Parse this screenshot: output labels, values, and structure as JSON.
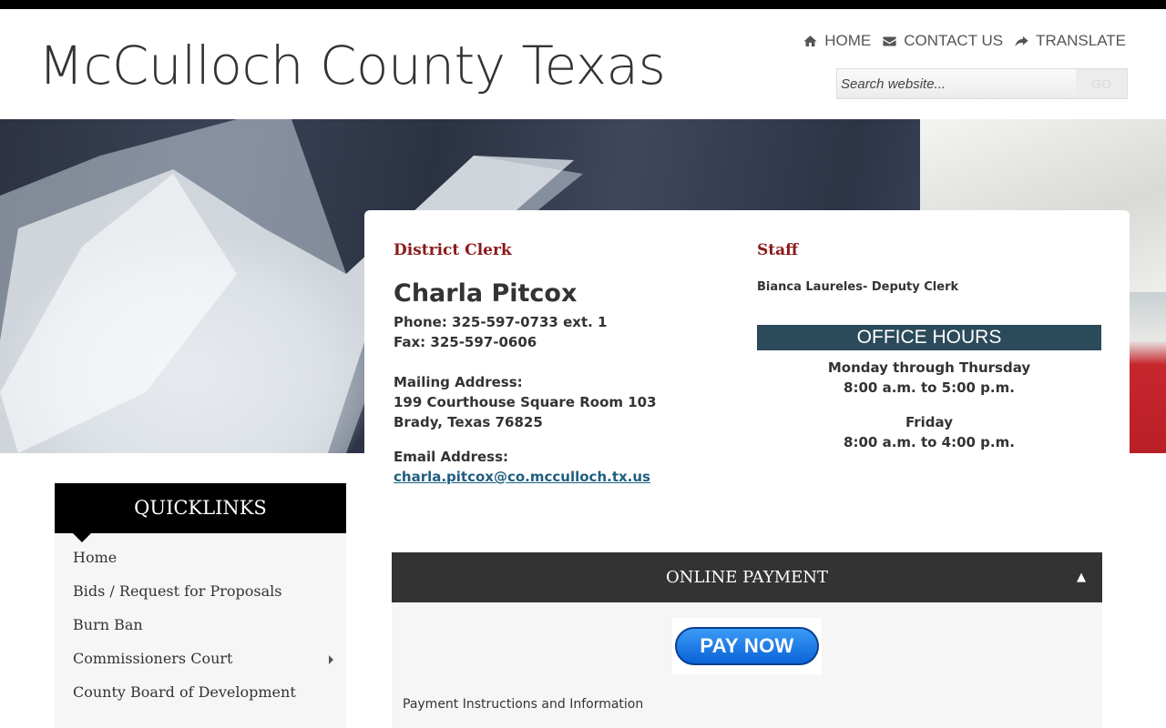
{
  "site": {
    "title": "McCulloch County Texas"
  },
  "topnav": {
    "items": [
      {
        "label": "HOME",
        "icon": "home-icon"
      },
      {
        "label": "CONTACT US",
        "icon": "envelope-icon"
      },
      {
        "label": "TRANSLATE",
        "icon": "share-icon"
      }
    ]
  },
  "search": {
    "placeholder": "Search website...",
    "button_label": "GO"
  },
  "contact": {
    "department": "District Clerk",
    "name": "Charla Pitcox",
    "phone": "Phone: 325-597-0733 ext. 1",
    "fax": "Fax: 325-597-0606",
    "mailing_label": "Mailing Address:",
    "address_line1": "199 Courthouse Square Room 103",
    "address_line2": "Brady, Texas 76825",
    "email_label": "Email Address:",
    "email": "charla.pitcox@co.mcculloch.tx.us"
  },
  "staff": {
    "heading": "Staff",
    "members": [
      "Bianca Laureles- Deputy Clerk"
    ]
  },
  "office_hours": {
    "title": "OFFICE HOURS",
    "blocks": [
      {
        "days": "Monday through Thursday",
        "hours": "8:00 a.m. to 5:00 p.m."
      },
      {
        "days": "Friday",
        "hours": "8:00 a.m. to 4:00 p.m."
      }
    ]
  },
  "quicklinks": {
    "title": "QUICKLINKS",
    "items": [
      {
        "label": "Home"
      },
      {
        "label": "Bids / Request for Proposals"
      },
      {
        "label": "Burn Ban"
      },
      {
        "label": "Commissioners Court"
      },
      {
        "label": "County Board of Development"
      }
    ]
  },
  "payment": {
    "title": "ONLINE PAYMENT",
    "toggle": "▲",
    "button_label": "PAY NOW",
    "instructions": "Payment Instructions and Information"
  },
  "colors": {
    "heading_red": "#8b1a1a",
    "hours_bar": "#2b4a5a",
    "link_blue": "#215f80",
    "pay_button": "#0a63d8"
  }
}
